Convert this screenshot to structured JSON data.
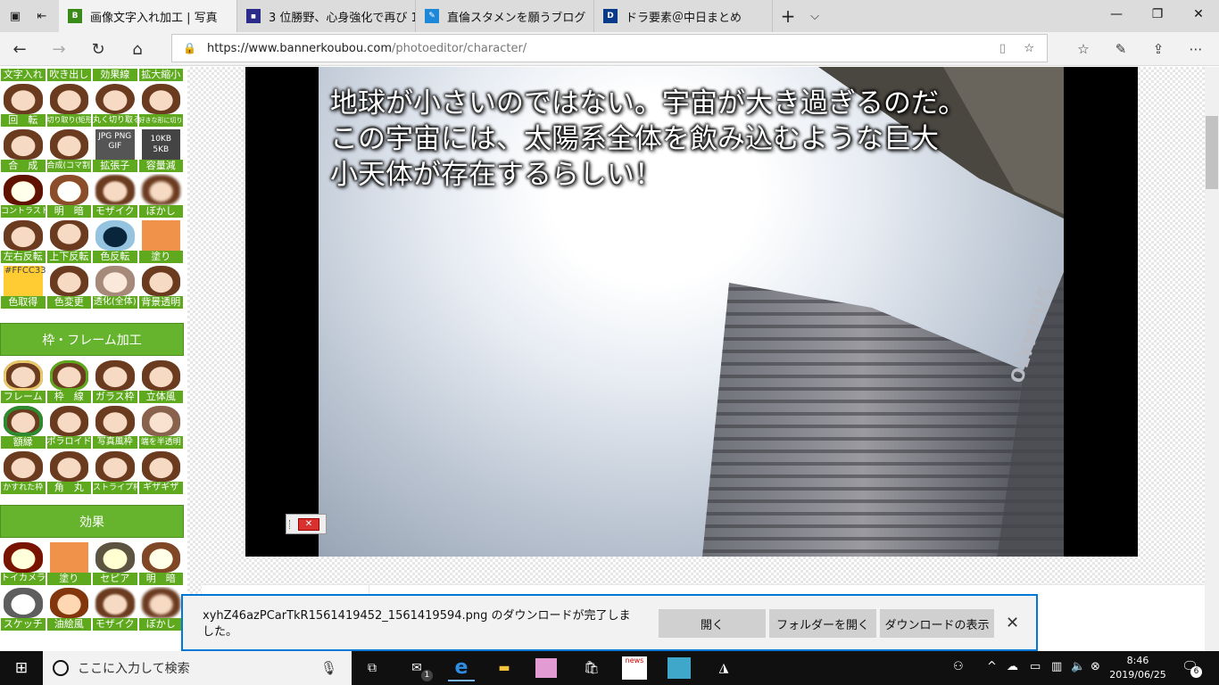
{
  "browser": {
    "tabs": [
      {
        "title": "画像文字入れ加工 | 写真",
        "favicon": "B",
        "favicon_color": "#3a8a1a",
        "active": true
      },
      {
        "title": "3 位勝野、心身強化で再び 1",
        "favicon": "news",
        "favicon_color": "#2b2b8a",
        "active": false
      },
      {
        "title": "直倫スタメンを願うブログ",
        "favicon": "pen",
        "favicon_color": "#1e88d8",
        "active": false
      },
      {
        "title": "ドラ要素＠中日まとめ",
        "favicon": "D",
        "favicon_color": "#0a3a8a",
        "active": false
      }
    ],
    "new_tab_label": "+",
    "tab_list_label": "⌵",
    "url_host": "https://www.bannerkoubou.com",
    "url_path": "/photoeditor/character/"
  },
  "sidebar": {
    "top_partial_labels": [
      "文字入れ",
      "吹き出し",
      "効果線",
      "拡大縮小"
    ],
    "tools_rows": [
      [
        "回　転",
        "切り取り(矩形)",
        "丸く切り取る",
        "好きな形に切り取る"
      ],
      [
        "合　成",
        "合成(コマ割)",
        "拡張子",
        "容量減"
      ],
      [
        "コントラスト",
        "明　暗",
        "モザイク",
        "ぼかし"
      ],
      [
        "左右反転",
        "上下反転",
        "色反転",
        "塗り"
      ],
      [
        "色取得",
        "色変更",
        "透化(全体)",
        "背景透明"
      ]
    ],
    "color_swatch_text": "#FFCC33",
    "ext_icon_text": "JPG PNG GIF",
    "size_icon_text": "10KB 5KB",
    "frame_section_title": "枠・フレーム加工",
    "frame_rows": [
      [
        "フレーム",
        "枠　線",
        "ガラス枠",
        "立体風"
      ],
      [
        "額縁",
        "ポラロイド",
        "写真風枠",
        "端を半透明"
      ],
      [
        "かすれた枠",
        "角　丸",
        "ストライプ枠",
        "ギザギザ"
      ]
    ],
    "effect_section_title": "効果",
    "effect_rows": [
      [
        "トイカメラ",
        "塗り",
        "セピア",
        "明　暗"
      ],
      [
        "スケッチ",
        "油絵風",
        "モザイク",
        "ぼかし"
      ]
    ]
  },
  "editor": {
    "caption_lines": [
      "地球が小さいのではない。宇宙が大き過ぎるのだ。",
      "この宇宙には、太陽系全体を飲み込むような巨大",
      "小天体が存在するらしい！"
    ],
    "building_sign": "OLYMPUS"
  },
  "download_bar": {
    "message": "xyhZ46azPCarTkR1561419452_1561419594.png のダウンロードが完了しました。",
    "open_label": "開く",
    "open_folder_label": "フォルダーを開く",
    "view_downloads_label": "ダウンロードの表示",
    "close_label": "✕"
  },
  "taskbar": {
    "search_placeholder": "ここに入力して検索",
    "mail_badge": "1",
    "news_badge": "news",
    "time": "8:46",
    "date": "2019/06/25",
    "notification_count": "6"
  }
}
